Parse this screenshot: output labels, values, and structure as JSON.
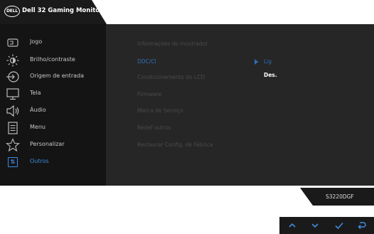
{
  "header": {
    "logo_text": "DELL",
    "title": "Dell 32 Gaming Monitor"
  },
  "menu": {
    "items": [
      {
        "label": "Jogo",
        "icon": "gamepad-icon"
      },
      {
        "label": "Brilho/contraste",
        "icon": "brightness-icon"
      },
      {
        "label": "Origem de entrada",
        "icon": "input-source-icon"
      },
      {
        "label": "Tela",
        "icon": "display-icon"
      },
      {
        "label": "Áudio",
        "icon": "speaker-icon"
      },
      {
        "label": "Menu",
        "icon": "menu-list-icon"
      },
      {
        "label": "Personalizar",
        "icon": "star-icon"
      },
      {
        "label": "Outros",
        "icon": "others-icon",
        "active": true
      }
    ]
  },
  "submenu": {
    "items": [
      "Informações do mostrador",
      "DDC/CI",
      "Condicionamento do LCD",
      "Firmware",
      "Marca de Serviço",
      "Redef outros",
      "Restaurar Config. de Fábrica"
    ],
    "selected_index": 1
  },
  "options": {
    "on": "Lig",
    "off": "Des."
  },
  "model": "S3220DGF",
  "nav": [
    "up-icon",
    "down-icon",
    "check-icon",
    "back-icon"
  ],
  "colors": {
    "accent": "#3f8be0",
    "panel_dark": "#141414",
    "panel_mid": "#262626"
  }
}
